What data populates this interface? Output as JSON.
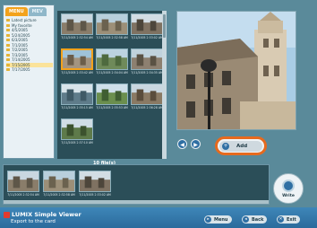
{
  "tabs": [
    {
      "label": "MENU",
      "active": true
    },
    {
      "label": "MEV",
      "active": false
    }
  ],
  "folders": [
    {
      "label": "Latest picture",
      "selected": false
    },
    {
      "label": "My favorite",
      "selected": false
    },
    {
      "label": "4/5/2005",
      "selected": false
    },
    {
      "label": "5/24/2005",
      "selected": false
    },
    {
      "label": "6/3/2005",
      "selected": false
    },
    {
      "label": "7/1/2005",
      "selected": false
    },
    {
      "label": "7/2/2005",
      "selected": false
    },
    {
      "label": "7/3/2005",
      "selected": false
    },
    {
      "label": "7/14/2005",
      "selected": false
    },
    {
      "label": "7/15/2005",
      "selected": true
    },
    {
      "label": "7/17/2005",
      "selected": false
    }
  ],
  "thumbnails": [
    {
      "caption": "7/11/2005 2:32:54 AM",
      "selected": false
    },
    {
      "caption": "7/11/2005 2:32:58 AM",
      "selected": false
    },
    {
      "caption": "7/11/2005 2:33:02 AM",
      "selected": false
    },
    {
      "caption": "7/11/2005 2:33:42 AM",
      "selected": true
    },
    {
      "caption": "7/11/2005 2:34:04 AM",
      "selected": false
    },
    {
      "caption": "7/11/2005 2:34:35 AM",
      "selected": false
    },
    {
      "caption": "7/11/2005 2:35:15 AM",
      "selected": false
    },
    {
      "caption": "7/11/2005 2:35:53 AM",
      "selected": false
    },
    {
      "caption": "7/11/2005 2:36:28 AM",
      "selected": false
    },
    {
      "caption": "7/11/2005 2:37:10 AM",
      "selected": false
    }
  ],
  "file_count": "10 file(s)",
  "add_label": "Add",
  "strip": [
    {
      "caption": "7/11/2005 2:32:54 AM"
    },
    {
      "caption": "7/11/2005 2:32:58 AM"
    },
    {
      "caption": "7/11/2005 2:33:02 AM"
    }
  ],
  "write_label": "Write",
  "footer": {
    "app_name": "LUMIX Simple Viewer",
    "subtitle": "Export to the card",
    "menu_label": "Menu",
    "back_label": "Back",
    "exit_label": "Exit"
  },
  "colors": {
    "background": "#5a8a9a",
    "accent_orange": "#e66a1e",
    "panel_dark": "#2b4e58",
    "button_blue": "#2f6fa3"
  }
}
